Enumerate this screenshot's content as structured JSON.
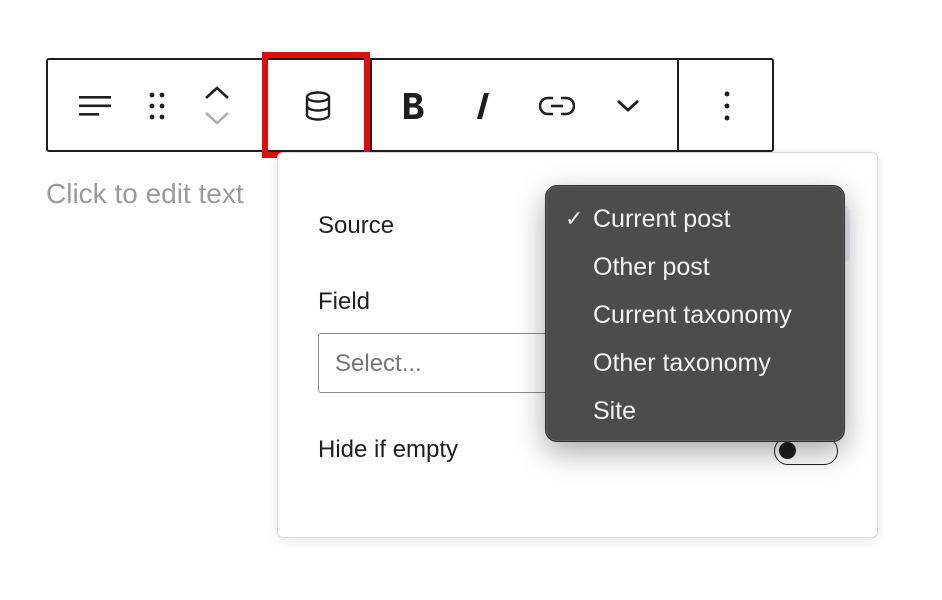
{
  "toolbar": {
    "buttons": [
      {
        "name": "align-icon"
      },
      {
        "name": "drag-handle-icon"
      },
      {
        "name": "move-up-icon"
      },
      {
        "name": "move-down-icon"
      },
      {
        "name": "database-icon"
      },
      {
        "name": "bold-icon"
      },
      {
        "name": "italic-icon"
      },
      {
        "name": "link-icon"
      },
      {
        "name": "chevron-down-icon"
      },
      {
        "name": "more-options-icon"
      }
    ],
    "highlight_color": "#e10d0d"
  },
  "editor": {
    "placeholder": "Click to edit text"
  },
  "panel": {
    "source_label": "Source",
    "field_label": "Field",
    "field_placeholder": "Select...",
    "hide_if_empty_label": "Hide if empty",
    "hide_if_empty_on": false
  },
  "source_menu": {
    "check_mark": "✓",
    "items": [
      "Current post",
      "Other post",
      "Current taxonomy",
      "Other taxonomy",
      "Site"
    ],
    "selected": "Current post",
    "background": "#4c4c4c"
  }
}
